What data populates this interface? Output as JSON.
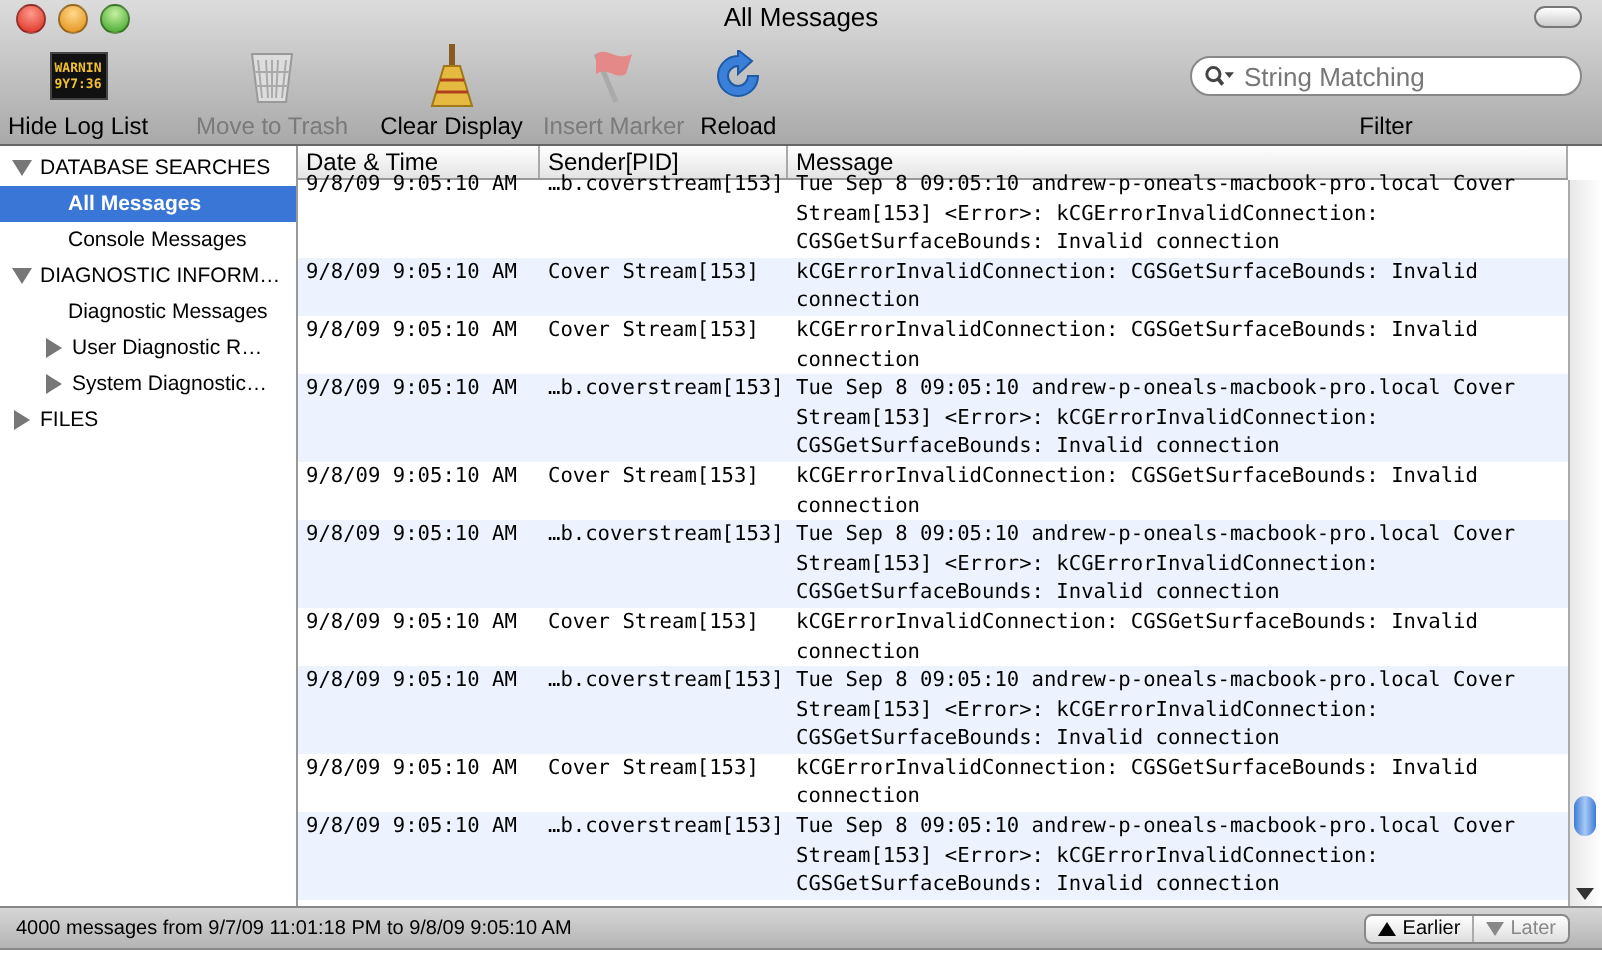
{
  "window": {
    "title": "All Messages"
  },
  "toolbar": [
    {
      "kind": "log",
      "label": "Hide Log List",
      "disabled": false
    },
    {
      "kind": "trash",
      "label": "Move to Trash",
      "disabled": true
    },
    {
      "kind": "broom",
      "label": "Clear Display",
      "disabled": false
    },
    {
      "kind": "flag",
      "label": "Insert Marker",
      "disabled": true
    },
    {
      "kind": "reload",
      "label": "Reload",
      "disabled": false
    }
  ],
  "log_display": {
    "lines": [
      "WARNIN",
      "9Y7:36"
    ]
  },
  "filter": {
    "placeholder": "String Matching",
    "label": "Filter"
  },
  "sidebar": [
    {
      "label": "DATABASE SEARCHES",
      "expanded": true,
      "children": [
        {
          "label": "All Messages",
          "selected": true
        },
        {
          "label": "Console Messages",
          "selected": false
        }
      ]
    },
    {
      "label": "DIAGNOSTIC INFORM…",
      "expanded": true,
      "children": [
        {
          "label": "Diagnostic Messages",
          "selected": false
        },
        {
          "label": "User Diagnostic R…",
          "selected": false,
          "expanded": false
        },
        {
          "label": "System Diagnostic…",
          "selected": false,
          "expanded": false
        }
      ]
    },
    {
      "label": "FILES",
      "expanded": false
    }
  ],
  "table": {
    "columns": [
      "Date & Time",
      "Sender[PID]",
      "Message"
    ],
    "rows": [
      {
        "date": "9/8/09 9:05:10 AM",
        "sender": "…b.coverstream[153]",
        "message": "Tue Sep  8 09:05:10 andrew-p-oneals-macbook-pro.local Cover Stream[153] <Error>: kCGErrorInvalidConnection: CGSGetSurfaceBounds: Invalid connection"
      },
      {
        "date": "9/8/09 9:05:10 AM",
        "sender": "Cover Stream[153]",
        "message": "kCGErrorInvalidConnection: CGSGetSurfaceBounds: Invalid connection"
      },
      {
        "date": "9/8/09 9:05:10 AM",
        "sender": "Cover Stream[153]",
        "message": "kCGErrorInvalidConnection: CGSGetSurfaceBounds: Invalid connection"
      },
      {
        "date": "9/8/09 9:05:10 AM",
        "sender": "…b.coverstream[153]",
        "message": "Tue Sep  8 09:05:10 andrew-p-oneals-macbook-pro.local Cover Stream[153] <Error>: kCGErrorInvalidConnection: CGSGetSurfaceBounds: Invalid connection"
      },
      {
        "date": "9/8/09 9:05:10 AM",
        "sender": "Cover Stream[153]",
        "message": "kCGErrorInvalidConnection: CGSGetSurfaceBounds: Invalid connection"
      },
      {
        "date": "9/8/09 9:05:10 AM",
        "sender": "…b.coverstream[153]",
        "message": "Tue Sep  8 09:05:10 andrew-p-oneals-macbook-pro.local Cover Stream[153] <Error>: kCGErrorInvalidConnection: CGSGetSurfaceBounds: Invalid connection"
      },
      {
        "date": "9/8/09 9:05:10 AM",
        "sender": "Cover Stream[153]",
        "message": "kCGErrorInvalidConnection: CGSGetSurfaceBounds: Invalid connection"
      },
      {
        "date": "9/8/09 9:05:10 AM",
        "sender": "…b.coverstream[153]",
        "message": "Tue Sep  8 09:05:10 andrew-p-oneals-macbook-pro.local Cover Stream[153] <Error>: kCGErrorInvalidConnection: CGSGetSurfaceBounds: Invalid connection"
      },
      {
        "date": "9/8/09 9:05:10 AM",
        "sender": "Cover Stream[153]",
        "message": "kCGErrorInvalidConnection: CGSGetSurfaceBounds: Invalid connection"
      },
      {
        "date": "9/8/09 9:05:10 AM",
        "sender": "…b.coverstream[153]",
        "message": "Tue Sep  8 09:05:10 andrew-p-oneals-macbook-pro.local Cover Stream[153] <Error>: kCGErrorInvalidConnection: CGSGetSurfaceBounds: Invalid connection"
      }
    ]
  },
  "status_bar": {
    "text": "4000 messages from 9/7/09 11:01:18 PM to 9/8/09 9:05:10 AM",
    "buttons": [
      {
        "label": "Earlier",
        "disabled": false
      },
      {
        "label": "Later",
        "disabled": true
      }
    ]
  }
}
